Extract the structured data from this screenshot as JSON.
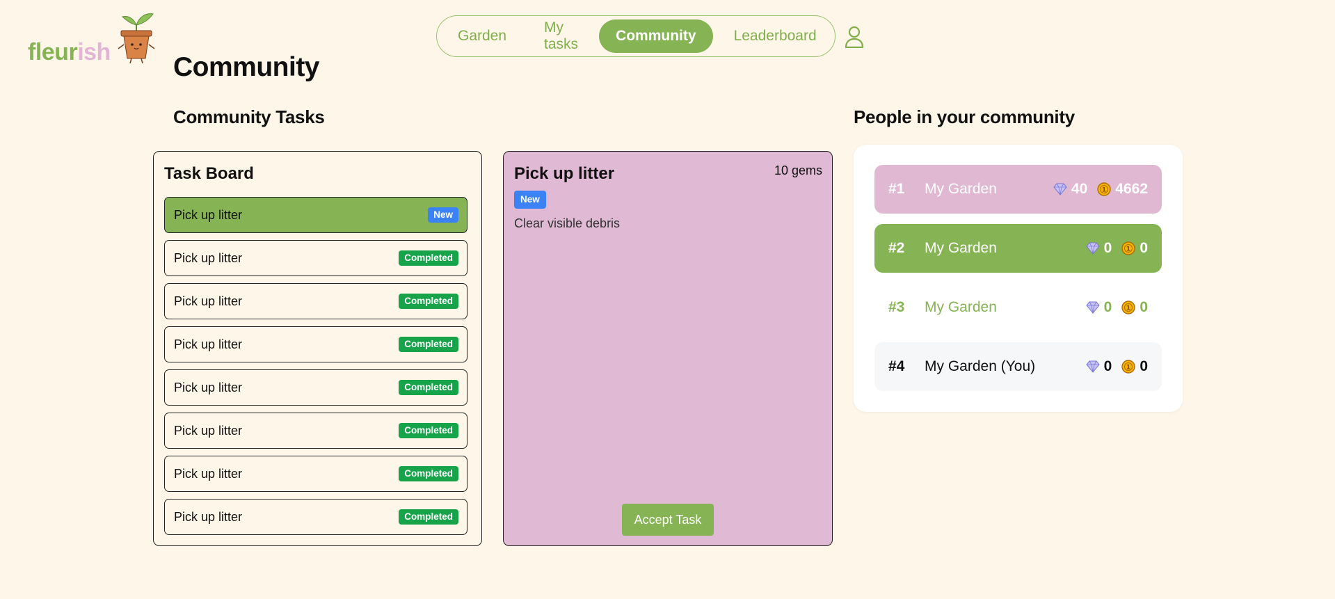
{
  "logo": {
    "text_a": "fleur",
    "text_b": "ish"
  },
  "nav": {
    "items": [
      {
        "label": "Garden",
        "active": false
      },
      {
        "label": "My tasks",
        "active": false
      },
      {
        "label": "Community",
        "active": true
      },
      {
        "label": "Leaderboard",
        "active": false
      }
    ]
  },
  "page": {
    "title": "Community",
    "tasks_heading": "Community Tasks",
    "people_heading": "People in your community"
  },
  "task_board": {
    "title": "Task Board",
    "tasks": [
      {
        "name": "Pick up litter",
        "status": "New",
        "selected": true
      },
      {
        "name": "Pick up litter",
        "status": "Completed"
      },
      {
        "name": "Pick up litter",
        "status": "Completed"
      },
      {
        "name": "Pick up litter",
        "status": "Completed"
      },
      {
        "name": "Pick up litter",
        "status": "Completed"
      },
      {
        "name": "Pick up litter",
        "status": "Completed"
      },
      {
        "name": "Pick up litter",
        "status": "Completed"
      },
      {
        "name": "Pick up litter",
        "status": "Completed"
      }
    ]
  },
  "detail": {
    "title": "Pick up litter",
    "reward": "10 gems",
    "status": "New",
    "description": "Clear visible debris",
    "accept_label": "Accept Task"
  },
  "people": [
    {
      "rank": "#1",
      "name": "My Garden",
      "gems": "40",
      "coins": "4662"
    },
    {
      "rank": "#2",
      "name": "My Garden",
      "gems": "0",
      "coins": "0"
    },
    {
      "rank": "#3",
      "name": "My Garden",
      "gems": "0",
      "coins": "0"
    },
    {
      "rank": "#4",
      "name": "My Garden (You)",
      "gems": "0",
      "coins": "0"
    }
  ],
  "icons": {
    "profile": "user-outline-icon",
    "gem": "gem-icon",
    "coin": "coin-icon",
    "logo": "plant-pot-mascot-icon"
  },
  "colors": {
    "background": "#fdf6e9",
    "accent_green": "#86b354",
    "accent_pink": "#e0b8d2",
    "badge_new": "#3b82f6",
    "badge_completed": "#16a34a"
  }
}
